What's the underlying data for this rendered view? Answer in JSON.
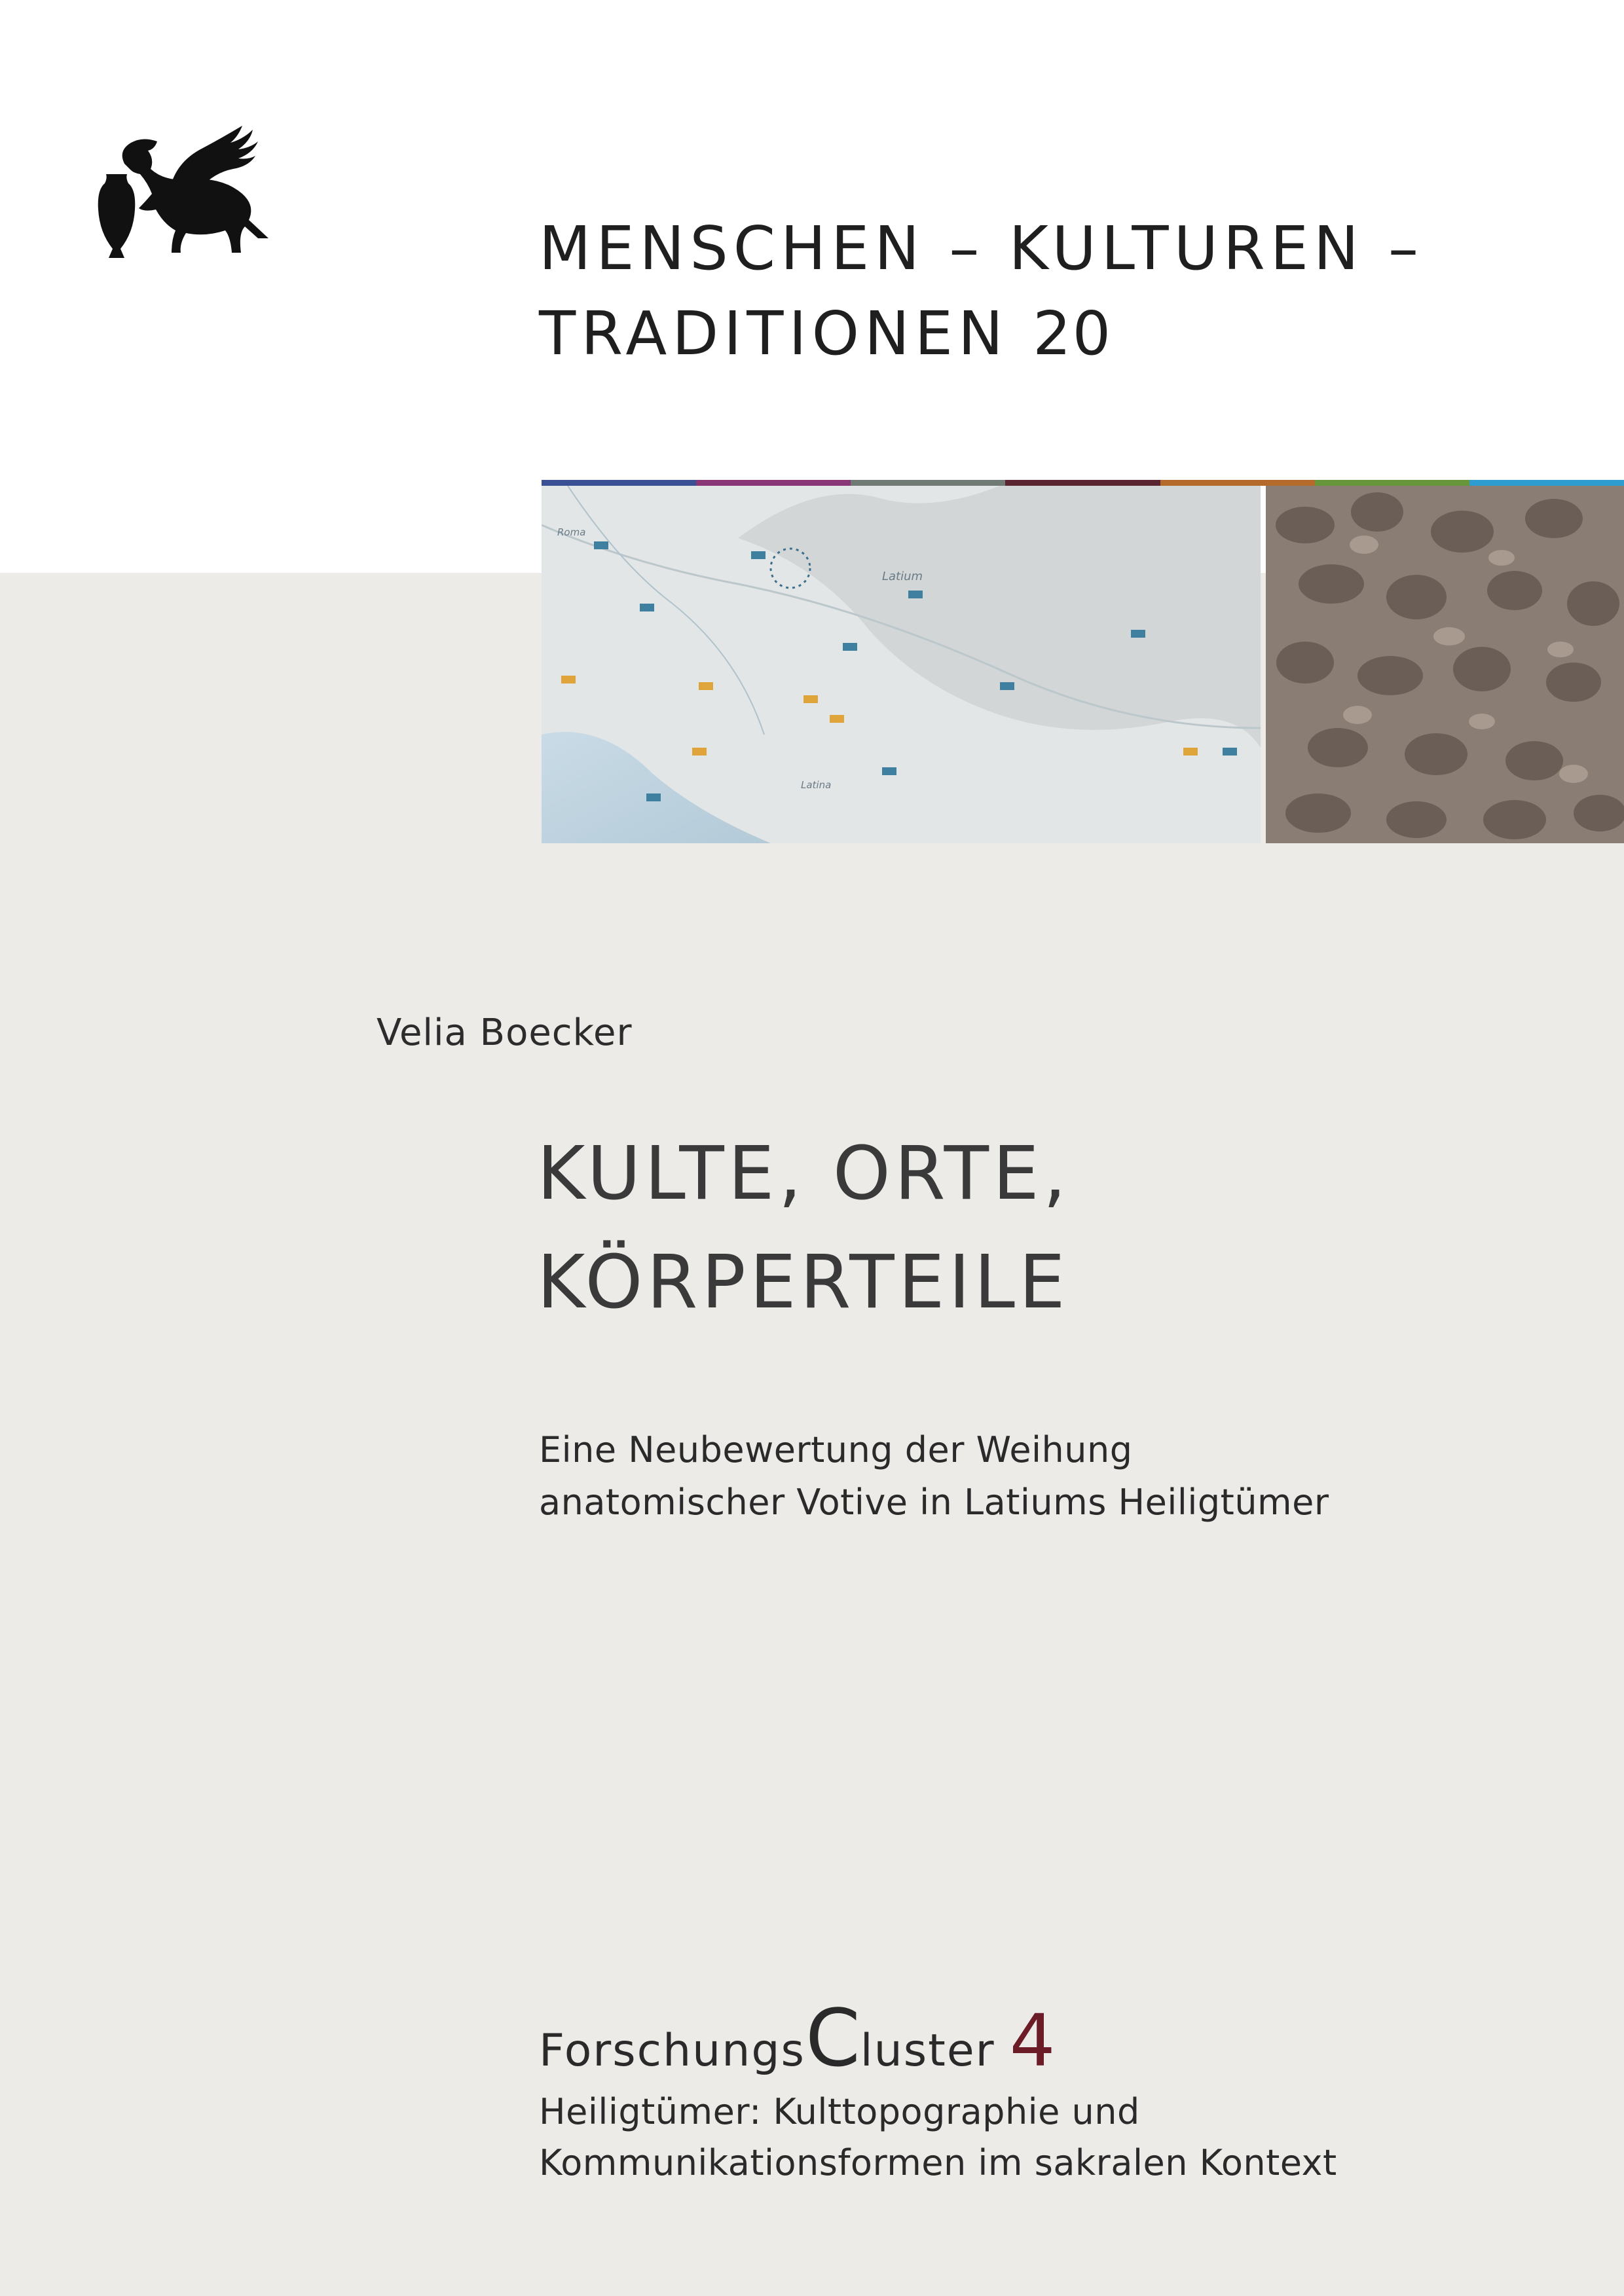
{
  "series": {
    "line1": "MENSCHEN – KULTUREN –",
    "line2": "TRADITIONEN",
    "number": "20"
  },
  "strip_colors": [
    "#3b4f95",
    "#8a3576",
    "#6f7a74",
    "#5a2430",
    "#b36a2b",
    "#67963a",
    "#2f9ccf"
  ],
  "map": {
    "label_region": "Latium",
    "label_city": "Roma",
    "label_town": "Latina"
  },
  "author": "Velia Boecker",
  "title": {
    "line1": "KULTE, ORTE,",
    "line2": "KÖRPERTEILE"
  },
  "subtitle": {
    "line1": "Eine Neubewertung der Weihung",
    "line2": "anatomischer Votive in Latiums Heiligtümer"
  },
  "cluster": {
    "part1": "Forschungs",
    "bigC": "C",
    "part2": "luster",
    "number": "4",
    "desc_line1": "Heiligtümer: Kulttopographie und",
    "desc_line2": "Kommunikationsformen im sakralen Kontext"
  }
}
